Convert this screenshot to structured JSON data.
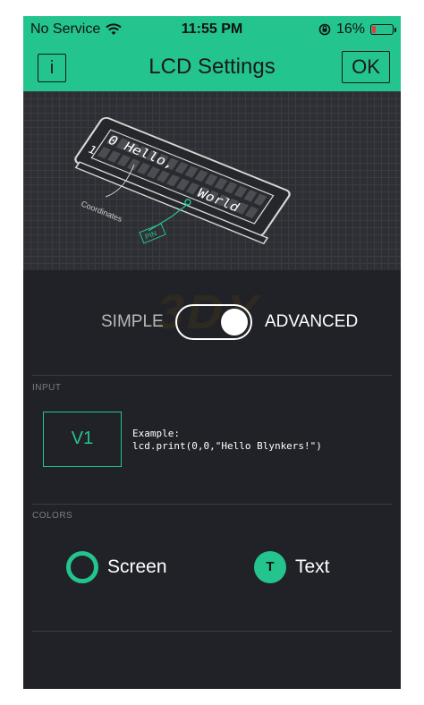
{
  "status": {
    "carrier": "No Service",
    "time": "11:55 PM",
    "battery": "16%",
    "battery_level": 0.16
  },
  "nav": {
    "info_label": "i",
    "title": "LCD Settings",
    "ok_label": "OK"
  },
  "preview": {
    "line1": "0 Hello,",
    "line2": "World",
    "row_index": "1",
    "coords_label": "Coordinates",
    "pin_label": "PIN"
  },
  "mode": {
    "simple_label": "SIMPLE",
    "advanced_label": "ADVANCED",
    "selected": "ADVANCED"
  },
  "input": {
    "section_label": "INPUT",
    "pin": "V1",
    "example_line1": "Example:",
    "example_line2": "lcd.print(0,0,\"Hello Blynkers!\")"
  },
  "colors": {
    "section_label": "COLORS",
    "screen_label": "Screen",
    "text_label": "Text",
    "text_icon_letter": "T",
    "accent": "#23c48e"
  },
  "watermark": "3DY"
}
